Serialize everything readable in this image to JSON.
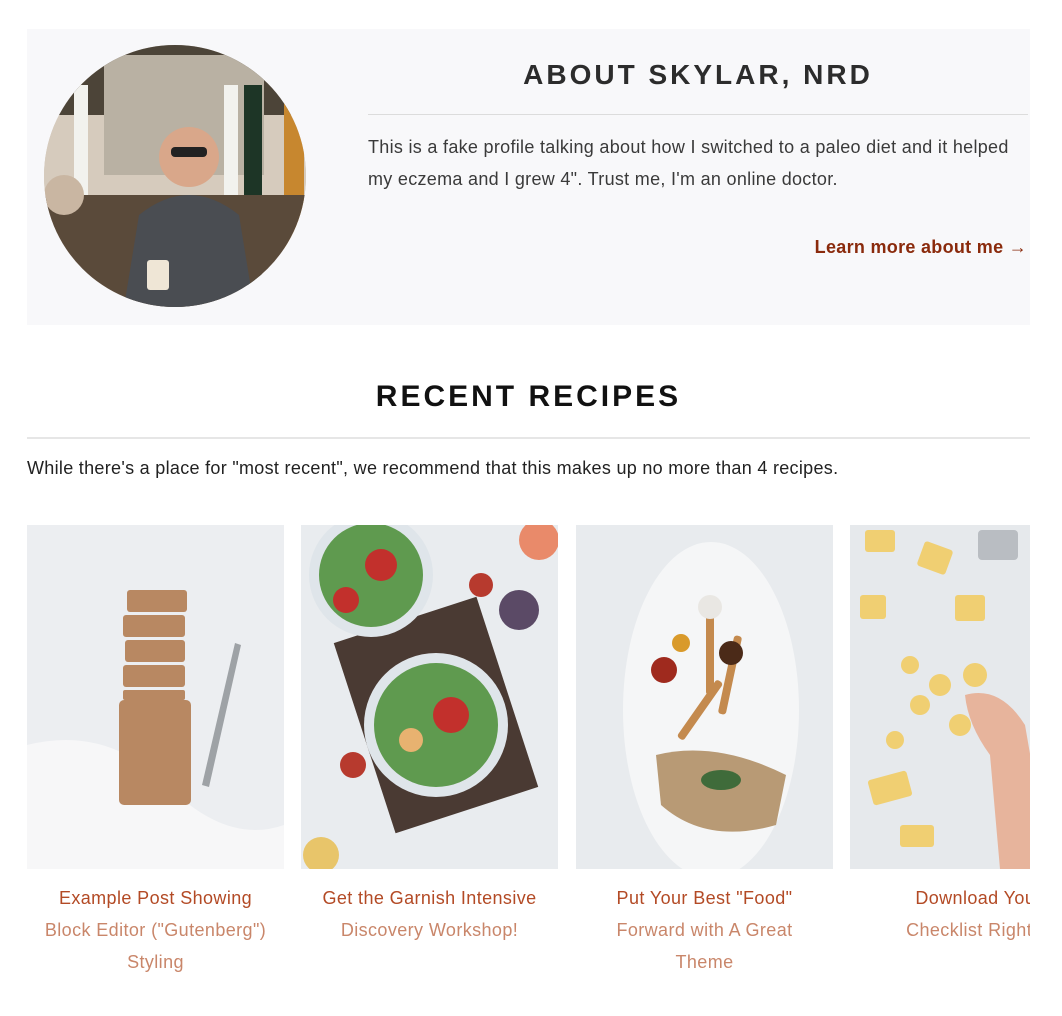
{
  "about": {
    "title": "ABOUT SKYLAR, NRD",
    "body": "This is a fake profile talking about how I switched to a paleo diet and it helped my eczema and I grew 4\". Trust me, I'm an online doctor.",
    "link_label": "Learn more about me →"
  },
  "recent": {
    "title": "RECENT RECIPES",
    "intro": "While there's a place for \"most recent\", we recommend that this makes up no more than 4 recipes.",
    "cards": [
      {
        "title_lines": [
          "Example Post Showing",
          "Block Editor (\"Gutenberg\")",
          "Styling"
        ],
        "image": "granola-bar-slices-photo"
      },
      {
        "title_lines": [
          "Get the Garnish Intensive",
          "Discovery Workshop!",
          ""
        ],
        "image": "fig-salad-photo"
      },
      {
        "title_lines": [
          "Put Your Best \"Food\"",
          "Forward with A Great",
          "Theme"
        ],
        "image": "spice-spoons-photo"
      },
      {
        "title_lines": [
          "Download Your",
          "Checklist Right H",
          ""
        ],
        "image": "fresh-pasta-photo"
      }
    ]
  },
  "colors": {
    "accent": "#8a2a0c",
    "link": "#c0552e",
    "panel": "#f8f8fa"
  }
}
